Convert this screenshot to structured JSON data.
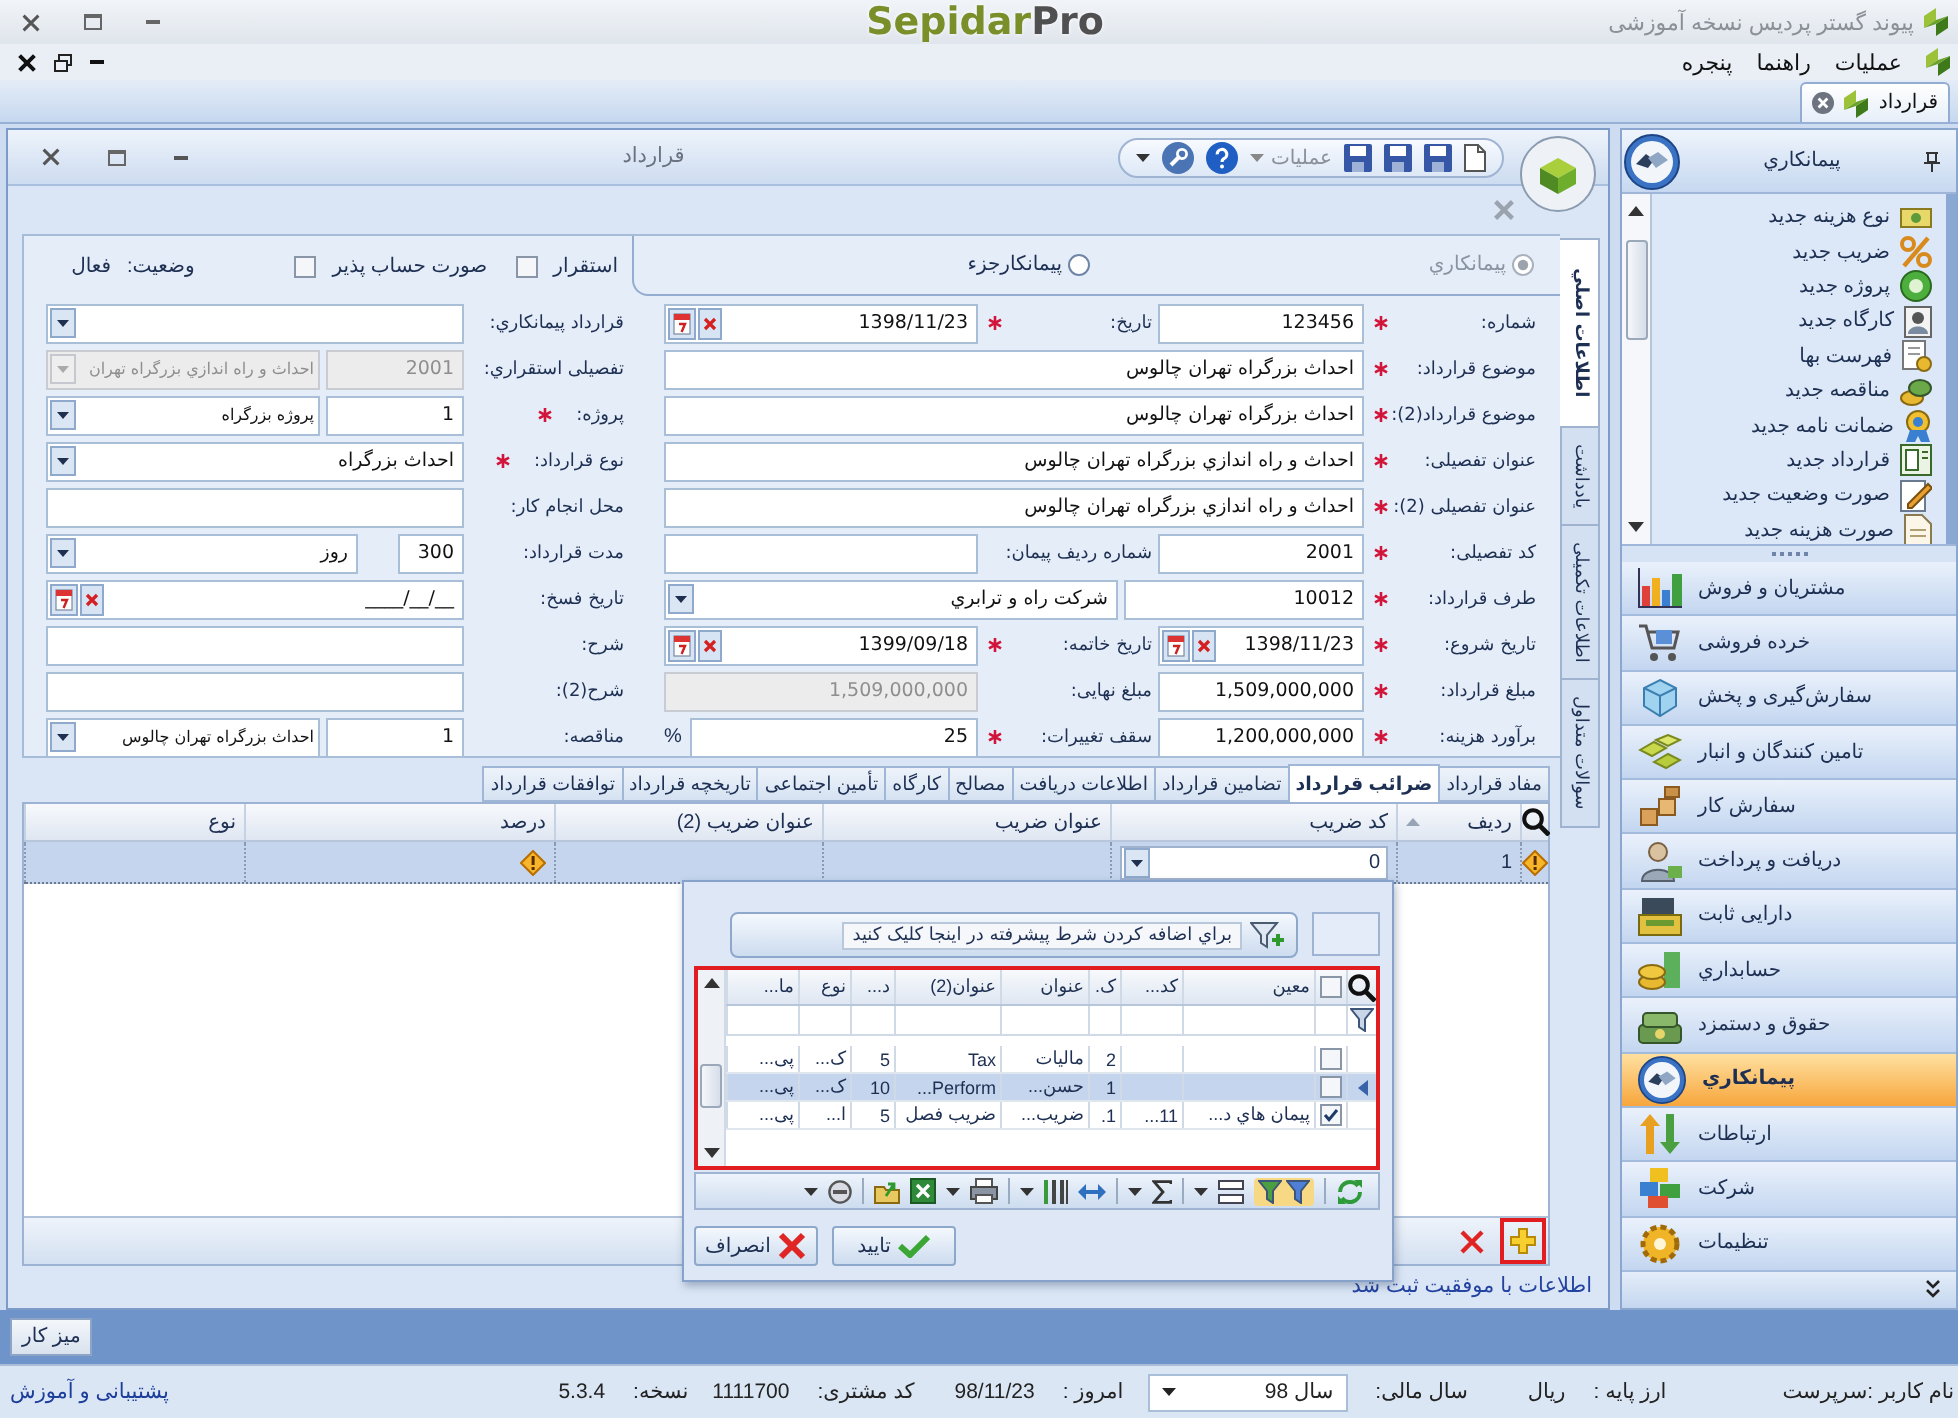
{
  "title_bar": {
    "logo": {
      "name": "Sepidar",
      "suffix": "Pro"
    },
    "title": "پیوند گستر پردیس نسخه آموزشی"
  },
  "menu": [
    "عملیات",
    "راهنما",
    "پنجره"
  ],
  "document_tabs": [
    {
      "label": "قرارداد",
      "selected": true
    }
  ],
  "window": {
    "title": "قرارداد",
    "menu_label": "عملیات"
  },
  "form": {
    "vertical_tabs": [
      {
        "label": "اطلاعات اصلي",
        "selected": true
      },
      {
        "label": "يادداشت",
        "selected": false
      },
      {
        "label": "اطلاعات تکمیلی",
        "selected": false
      },
      {
        "label": "سوالات متداول",
        "selected": false
      }
    ],
    "contractor_types": [
      {
        "label": "پیمانکاري",
        "selected": true,
        "disabled": true
      },
      {
        "label": "پیمانکارجزء",
        "selected": false,
        "disabled": false
      }
    ],
    "flags": [
      {
        "label": "استقرار",
        "checked": false
      },
      {
        "label": "صورت حساب پذیر",
        "checked": false
      }
    ],
    "status": {
      "label": "وضعیت:",
      "value": "فعال"
    },
    "rows": [
      [
        {
          "label": "شماره:",
          "required": true,
          "field": {
            "kind": "text",
            "value": "123456",
            "disabled": false
          }
        },
        {
          "label": "تاریخ:",
          "required": true,
          "field": {
            "kind": "date",
            "value": "1398/11/23",
            "disabled": false
          }
        },
        {
          "label": "قرارداد پیمانکاري:",
          "required": false,
          "field": {
            "kind": "combo",
            "disabled": false
          }
        }
      ],
      [
        {
          "label": "موضوع قرارداد:",
          "required": true,
          "field": {
            "kind": "text",
            "value": "احداث بزرگراه تهران چالوس",
            "disabled": false
          }
        },
        {
          "label": "تفصیلی استقراري:",
          "required": false,
          "field": {
            "kind": "lookup",
            "code": "2001",
            "value": "احداث و راه اندازي بزرگراه تهران",
            "disabled": true
          }
        }
      ],
      [
        {
          "label": "موضوع قرارداد(2):",
          "required": true,
          "field": {
            "kind": "text",
            "value": "احداث بزرگراه تهران چالوس",
            "disabled": false
          }
        },
        {
          "label": "پروژه:",
          "required": true,
          "field": {
            "kind": "lookup",
            "code": "1",
            "value": "پروژه بزرگراه",
            "disabled": false
          }
        }
      ],
      [
        {
          "label": "عنوان تفصیلی:",
          "required": true,
          "field": {
            "kind": "text",
            "value": "احداث و راه اندازي بزرگراه تهران چالوس",
            "disabled": false
          }
        },
        {
          "label": "نوع قرارداد:",
          "required": true,
          "field": {
            "kind": "combo",
            "value": "احداث بزرگراه",
            "disabled": false
          }
        }
      ],
      [
        {
          "label": "عنوان تفصیلی (2):",
          "required": true,
          "field": {
            "kind": "text",
            "value": "احداث و راه اندازي بزرگراه تهران چالوس",
            "disabled": false
          }
        },
        {
          "label": "محل انجام کار:",
          "required": false,
          "field": {
            "kind": "text",
            "disabled": false
          }
        }
      ],
      [
        {
          "label": "کد تفصیلی:",
          "required": true,
          "field": {
            "kind": "text",
            "value": "2001",
            "disabled": false
          }
        },
        {
          "label": "شماره ردیف پیمان:",
          "required": false,
          "field": {
            "kind": "text",
            "disabled": false
          }
        },
        {
          "label": "مدت قرارداد:",
          "required": false,
          "field": {
            "kind": "quantity",
            "value": "300",
            "unit": "روز",
            "disabled": false
          }
        }
      ],
      [
        {
          "label": "طرف قرارداد:",
          "required": true,
          "field": {
            "kind": "lookup",
            "code": "10012",
            "value": "شرکت راه و ترابري",
            "disabled": false
          }
        },
        {
          "label": "تاریخ فسخ:",
          "required": false,
          "field": {
            "kind": "date",
            "value": "____/__/__",
            "disabled": false
          }
        }
      ],
      [
        {
          "label": "تاریخ شروع:",
          "required": true,
          "field": {
            "kind": "date",
            "value": "1398/11/23",
            "disabled": false
          }
        },
        {
          "label": "تاریخ خاتمه:",
          "required": true,
          "field": {
            "kind": "date",
            "value": "1399/09/18",
            "disabled": false
          }
        },
        {
          "label": "شرح:",
          "required": false,
          "field": {
            "kind": "text",
            "disabled": false
          }
        }
      ],
      [
        {
          "label": "مبلغ قرارداد:",
          "required": true,
          "field": {
            "kind": "text",
            "value": "1,509,000,000",
            "disabled": false
          }
        },
        {
          "label": "مبلغ نهایی:",
          "required": false,
          "field": {
            "kind": "text",
            "value": "1,509,000,000",
            "disabled": true
          }
        },
        {
          "label": "شرح(2):",
          "required": false,
          "field": {
            "kind": "text",
            "disabled": false
          }
        }
      ],
      [
        {
          "label": "برآورد هزینه:",
          "required": true,
          "field": {
            "kind": "text",
            "value": "1,200,000,000",
            "disabled": false
          }
        },
        {
          "label": "سقف تغییرات:",
          "required": true,
          "field": {
            "kind": "text",
            "value": "25",
            "unit": "%",
            "disabled": false
          }
        },
        {
          "label": "مناقصه:",
          "required": false,
          "field": {
            "kind": "lookup",
            "code": "1",
            "value": "احداث بزرگراه تهران چالوس",
            "disabled": false
          }
        }
      ]
    ]
  },
  "detail_tabs": [
    {
      "label": "مفاد قرارداد",
      "selected": false
    },
    {
      "label": "ضرائب قرارداد",
      "selected": true
    },
    {
      "label": "تضامین قرارداد",
      "selected": false
    },
    {
      "label": "اطلاعات دریافت",
      "selected": false
    },
    {
      "label": "مصالح",
      "selected": false
    },
    {
      "label": "کارگاه",
      "selected": false
    },
    {
      "label": "تأمین اجتماعی",
      "selected": false
    },
    {
      "label": "تاریخچه قرارداد",
      "selected": false
    },
    {
      "label": "توافقات قرارداد",
      "selected": false
    }
  ],
  "tax_grid": {
    "columns": [
      {
        "label": "ردیف",
        "sorted": true
      },
      {
        "label": "کد ضریب",
        "sorted": false
      },
      {
        "label": "عنوان ضریب",
        "sorted": false
      },
      {
        "label": "عنوان ضریب (2)",
        "sorted": false
      },
      {
        "label": "درصد",
        "sorted": false
      },
      {
        "label": "نوع",
        "sorted": false
      }
    ],
    "rows": [
      {
        "cells": [
          "1",
          "0",
          null,
          null,
          null,
          null
        ],
        "selected": true,
        "error": true
      }
    ],
    "add_highlighted": true
  },
  "lookup_popup": {
    "filter_button": "براي اضافه کردن شرط پیشرفته در اینجا کلیک کنید",
    "highlighted": true,
    "all_checked": false,
    "columns": [
      "معین",
      "کد...",
      "ک.",
      "عنوان",
      "عنوان(2)",
      "د...",
      "نوع",
      "ما..."
    ],
    "rows": [
      {
        "checked": false,
        "selected": false,
        "cells": [
          null,
          null,
          "2",
          "مالیات",
          "Tax",
          "5",
          "ک...",
          "پی..."
        ]
      },
      {
        "checked": false,
        "selected": true,
        "cells": [
          null,
          null,
          "1",
          "حسن...",
          "Perform...",
          "10",
          "ک...",
          "پی..."
        ]
      },
      {
        "checked": true,
        "selected": false,
        "cells": [
          "پیمان هاي د...",
          "11...",
          "1.",
          "ضریب...",
          "ضریب فصل",
          "5",
          "ا...",
          "پی..."
        ]
      }
    ],
    "ok_button": "تایید",
    "cancel_button": "انصراف"
  },
  "status_message": "اطلاعات با موفقیت ثبت شد",
  "sidebar": {
    "title": "پیمانکاري",
    "tasks": [
      "نوع هزینه جدید",
      "ضریب جدید",
      "پروژه جدید",
      "کارگاه جدید",
      "فهرست بها",
      "مناقصه جدید",
      "ضمانت نامه جدید",
      "قرارداد جدید",
      "صورت وضعیت جدید",
      "صورت هزینه جدید"
    ],
    "modules": [
      {
        "label": "مشتریان و فروش",
        "selected": false
      },
      {
        "label": "خرده فروشی",
        "selected": false
      },
      {
        "label": "سفارش‌گیری و پخش",
        "selected": false
      },
      {
        "label": "تامین کنندگان و انبار",
        "selected": false
      },
      {
        "label": "سفارش کار",
        "selected": false
      },
      {
        "label": "دریافت و پرداخت",
        "selected": false
      },
      {
        "label": "دارایی ثابت",
        "selected": false
      },
      {
        "label": "حسابداري",
        "selected": false
      },
      {
        "label": "حقوق و دستمزد",
        "selected": false
      },
      {
        "label": "پیمانکاري",
        "selected": true
      },
      {
        "label": "ارتباطات",
        "selected": false
      },
      {
        "label": "شرکت",
        "selected": false
      },
      {
        "label": "تنظیمات",
        "selected": false
      }
    ]
  },
  "taskbar": {
    "desktop_button": "میز کار"
  },
  "status_bar": {
    "user": "نام کاربر :سرپرست",
    "currency": {
      "label": "ارز پایه :",
      "value": "ریال"
    },
    "fiscal_year": {
      "label": "سال مالی:",
      "value": "سال 98"
    },
    "today": {
      "label": "امروز :",
      "value": "98/11/23"
    },
    "customer_code": {
      "label": "کد مشتری:",
      "value": "1111700"
    },
    "version": {
      "label": "نسخه:",
      "value": "5.3.4"
    },
    "support_link": "پشتیبانی و آموزش"
  }
}
